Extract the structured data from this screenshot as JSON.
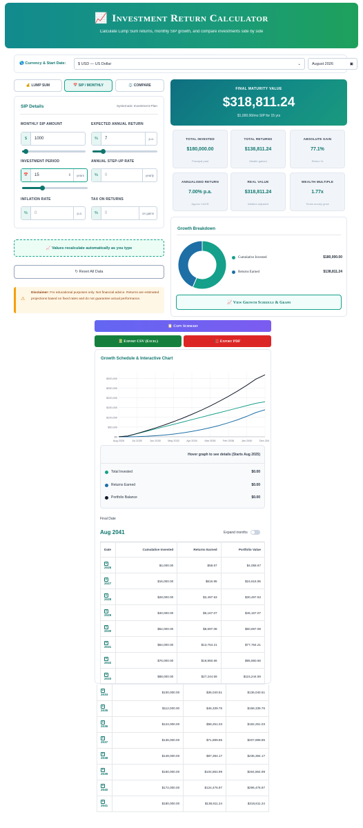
{
  "header": {
    "icon": "📈",
    "title": "Investment Return Calculator",
    "subtitle": "Calculate Lump Sum returns, monthly SIP growth, and compare investments side by side"
  },
  "settings": {
    "label": "Currency & Start Date:",
    "currency": "$ USD — US Dollar",
    "start_date": "August 2026"
  },
  "tabs": [
    {
      "label": "💰 LUMP SUM"
    },
    {
      "label": "📅 SIP / MONTHLY"
    },
    {
      "label": "⚖️ COMPARE"
    }
  ],
  "sip": {
    "title": "SIP Details",
    "subtitle": "Systematic Investment Plan",
    "monthly_label": "MONTHLY SIP AMOUNT",
    "monthly_prefix": "$",
    "monthly_value": "1000",
    "monthly_level": 0.05,
    "return_label": "EXPECTED ANNUAL RETURN",
    "return_prefix": "%",
    "return_value": "7",
    "return_suffix": "p.a.",
    "return_level": 0.16,
    "period_label": "INVESTMENT PERIOD",
    "period_prefix": "📅",
    "period_value": "15",
    "period_suffix": "years",
    "period_level": 0.3,
    "stepup_label": "ANNUAL STEP-UP RATE",
    "stepup_prefix": "%",
    "stepup_placeholder": "0",
    "stepup_suffix": "yearly",
    "inflation_label": "INFLATION RATE",
    "inflation_prefix": "%",
    "inflation_placeholder": "0",
    "inflation_suffix": "p.a.",
    "tax_label": "TAX ON RETURNS",
    "tax_prefix": "%",
    "tax_placeholder": "0",
    "tax_suffix": "on gains"
  },
  "recalc": "📈 Values recalculate automatically as you type",
  "reset": "↻ Reset All Data",
  "disclaimer": {
    "bold": "Disclaimer:",
    "text": " For educational purposes only. Not financial advice. Returns are estimated projections based on fixed rates and do not guarantee actual performance."
  },
  "maturity": {
    "label": "FINAL MATURITY VALUE",
    "value": "$318,811.24",
    "note": "$1,000.00/mo SIP for 15 yrs"
  },
  "stats": [
    {
      "label": "TOTAL INVESTED",
      "value": "$180,000.00",
      "note": "Principal paid"
    },
    {
      "label": "TOTAL RETURNS",
      "value": "$138,811.24",
      "note": "Wealth gained"
    },
    {
      "label": "ABSOLUTE GAIN",
      "value": "77.1%",
      "note": "Return %"
    },
    {
      "label": "ANNUALISED RETURN",
      "value": "7.00% p.a.",
      "note": "Approx CAGR"
    },
    {
      "label": "REAL VALUE",
      "value": "$318,811.24",
      "note": "Inflation adjusted"
    },
    {
      "label": "WEALTH MULTIPLE",
      "value": "1.77x",
      "note": "Times money grew"
    }
  ],
  "breakdown": {
    "title": "Growth Breakdown",
    "items": [
      {
        "label": "Cumulative Invested",
        "value": "$180,000.00",
        "color": "#14a08a"
      },
      {
        "label": "Returns Earned",
        "value": "$138,811.24",
        "color": "#1d6fa5"
      }
    ],
    "view_button": "📈 View Growth Schedule & Graph"
  },
  "actions": {
    "copy": "📋 Copy Summary",
    "csv": "📗 Export CSV (Excel)",
    "pdf": "📕 Export PDF"
  },
  "schedule": {
    "title": "Growth Schedule & Interactive Chart",
    "hover_title": "Hover graph to see details (Starts Aug 2025)",
    "hover_rows": [
      {
        "label": "Total Invested",
        "value": "$0.00",
        "color": "#14a08a"
      },
      {
        "label": "Returns Earned",
        "value": "$0.00",
        "color": "#1d6fa5"
      },
      {
        "label": "Portfolio Balance",
        "value": "$0.00",
        "color": "#111827"
      }
    ],
    "final_label": "Final Date",
    "final_date": "Aug 2041",
    "expand_label": "Expand months",
    "columns": [
      "Date",
      "Cumulative Invested",
      "Returns Earned",
      "Portfolio Value"
    ],
    "rows": [
      [
        "2026",
        "$4,000.00",
        "$58.67",
        "$4,058.67"
      ],
      [
        "2027",
        "$16,000.00",
        "$616.95",
        "$16,616.95"
      ],
      [
        "2028",
        "$28,000.00",
        "$2,497.53",
        "$30,497.53"
      ],
      [
        "2029",
        "$40,000.00",
        "$5,167.07",
        "$45,167.07"
      ],
      [
        "2030",
        "$52,000.00",
        "$8,697.08",
        "$60,697.08"
      ],
      [
        "2031",
        "$64,000.00",
        "$13,764.21",
        "$77,764.21"
      ],
      [
        "2032",
        "$76,000.00",
        "$19,850.66",
        "$95,850.66"
      ],
      [
        "2033",
        "$88,000.00",
        "$27,244.59",
        "$115,244.59"
      ],
      [
        "2034",
        "$100,000.00",
        "$36,040.51",
        "$136,040.51"
      ],
      [
        "2035",
        "$112,000.00",
        "$46,339.76",
        "$158,339.76"
      ],
      [
        "2036",
        "$124,000.00",
        "$58,251.03",
        "$182,251.03"
      ],
      [
        "2037",
        "$136,000.00",
        "$71,899.85",
        "$207,899.85"
      ],
      [
        "2038",
        "$148,000.00",
        "$87,384.17",
        "$235,384.17"
      ],
      [
        "2039",
        "$160,000.00",
        "$104,864.99",
        "$264,864.99"
      ],
      [
        "2040",
        "$172,000.00",
        "$124,476.97",
        "$296,476.97"
      ],
      [
        "2041",
        "$180,000.00",
        "$138,811.24",
        "$318,811.24"
      ]
    ]
  },
  "chart_data": {
    "type": "line",
    "x": [
      "Aug 2026",
      "Jul 2028",
      "Jun 2030",
      "May 2032",
      "Apr 2034",
      "Mar 2036",
      "Feb 2038",
      "Jan 2040",
      "Dec 2041"
    ],
    "x_values": [
      2026,
      2027,
      2028,
      2029,
      2030,
      2031,
      2032,
      2033,
      2034,
      2035,
      2036,
      2037,
      2038,
      2039,
      2040,
      2041
    ],
    "yticks": [
      "$0",
      "$50,000",
      "$100,000",
      "$150,000",
      "$200,000",
      "$250,000",
      "$300,000"
    ],
    "ylim": [
      0,
      330000
    ],
    "series": [
      {
        "name": "Total Invested",
        "color": "#14a08a",
        "values": [
          4000,
          16000,
          28000,
          40000,
          52000,
          64000,
          76000,
          88000,
          100000,
          112000,
          124000,
          136000,
          148000,
          160000,
          172000,
          180000
        ]
      },
      {
        "name": "Returns Earned",
        "color": "#1d6fa5",
        "values": [
          58.67,
          616.95,
          2497.53,
          5167.07,
          8697.08,
          13764.21,
          19850.66,
          27244.59,
          36040.51,
          46339.76,
          58251.03,
          71899.85,
          87384.17,
          104864.99,
          124476.97,
          138811.24
        ]
      },
      {
        "name": "Portfolio Balance",
        "color": "#111827",
        "values": [
          4058.67,
          16616.95,
          30497.53,
          45167.07,
          60697.08,
          77764.21,
          95850.66,
          115244.59,
          136040.51,
          158339.76,
          182251.03,
          207899.85,
          235384.17,
          264864.99,
          296476.97,
          318811.24
        ]
      }
    ]
  },
  "colors": {
    "primary": "#0f766e",
    "accent": "#14a08a",
    "blue": "#1d6fa5",
    "copy": "#6366f1",
    "csv": "#15803d",
    "pdf": "#dc2626"
  }
}
